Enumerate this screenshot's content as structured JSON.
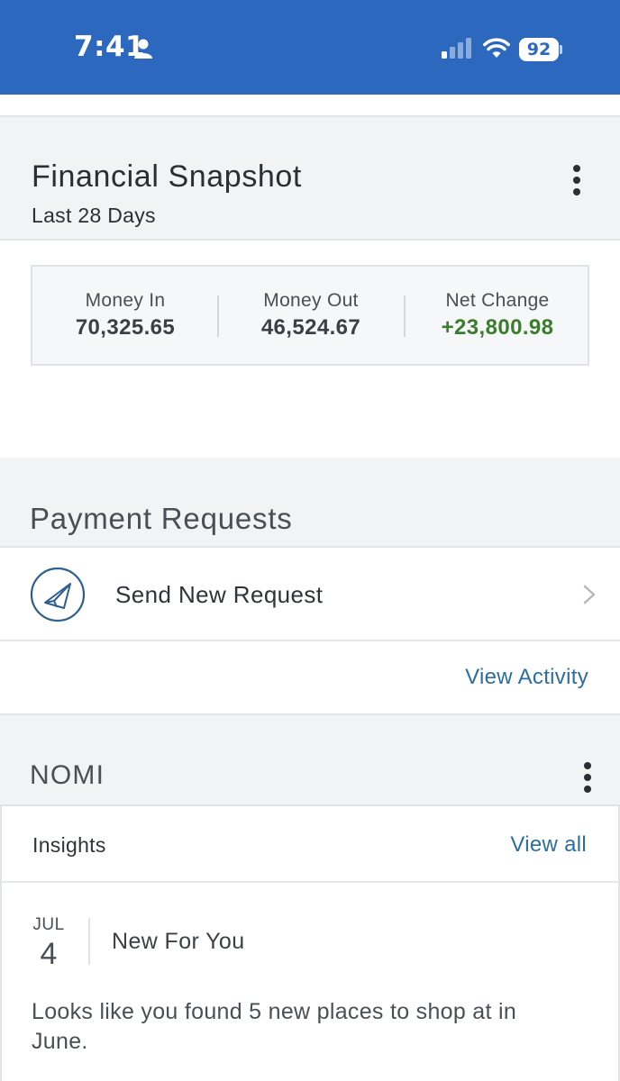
{
  "status_bar": {
    "time": "7:41",
    "battery": "92",
    "bg_color": "#2c68bd"
  },
  "financial_snapshot": {
    "title": "Financial Snapshot",
    "subtitle": "Last 28 Days",
    "money_in_label": "Money In",
    "money_in_value": "70,325.65",
    "money_out_label": "Money Out",
    "money_out_value": "46,524.67",
    "net_change_label": "Net Change",
    "net_change_value": "+23,800.98",
    "positive_color": "#3a7d2c"
  },
  "payment_requests": {
    "title": "Payment Requests",
    "send_label": "Send New Request",
    "view_activity": "View Activity",
    "link_color": "#2c6ea3"
  },
  "nomi": {
    "title": "NOMI",
    "insights_label": "Insights",
    "view_all": "View all",
    "insight": {
      "month": "JUL",
      "day": "4",
      "title": "New For You",
      "body": "Looks like you found 5 new places to shop at in June."
    }
  }
}
